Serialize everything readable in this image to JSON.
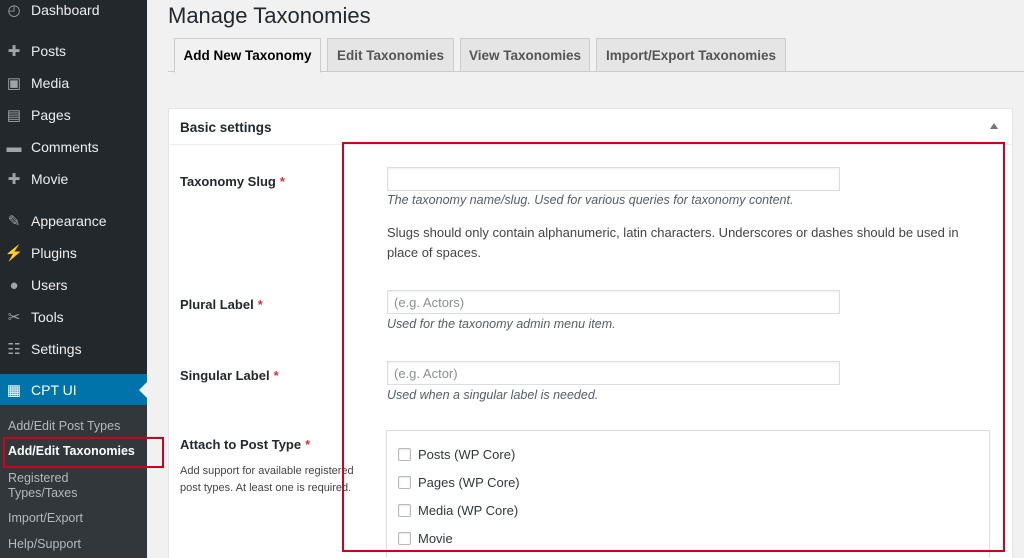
{
  "sidebar": {
    "items": [
      {
        "label": "Dashboard",
        "icon": "dashboard-icon"
      },
      {
        "label": "Posts",
        "icon": "pin-icon"
      },
      {
        "label": "Media",
        "icon": "media-icon"
      },
      {
        "label": "Pages",
        "icon": "pages-icon"
      },
      {
        "label": "Comments",
        "icon": "comments-icon"
      },
      {
        "label": "Movie",
        "icon": "pin-icon"
      },
      {
        "label": "Appearance",
        "icon": "appearance-icon"
      },
      {
        "label": "Plugins",
        "icon": "plugins-icon"
      },
      {
        "label": "Users",
        "icon": "users-icon"
      },
      {
        "label": "Tools",
        "icon": "tools-icon"
      },
      {
        "label": "Settings",
        "icon": "settings-icon"
      },
      {
        "label": "CPT UI",
        "icon": "grid-icon"
      }
    ],
    "submenu": [
      "Add/Edit Post Types",
      "Add/Edit Taxonomies",
      "Registered",
      "Types/Taxes",
      "Import/Export",
      "Help/Support"
    ]
  },
  "page": {
    "title": "Manage Taxonomies"
  },
  "tabs": [
    "Add New Taxonomy",
    "Edit Taxonomies",
    "View Taxonomies",
    "Import/Export Taxonomies"
  ],
  "panel": {
    "title": "Basic settings",
    "required_marker": "*",
    "slug": {
      "label": "Taxonomy Slug",
      "value": "",
      "help": "The taxonomy name/slug. Used for various queries for taxonomy content.",
      "note_line1": "Slugs should only contain alphanumeric, latin characters. Underscores or dashes should be used in",
      "note_line2": "place of spaces."
    },
    "plural": {
      "label": "Plural Label",
      "placeholder": "(e.g. Actors)",
      "help": "Used for the taxonomy admin menu item."
    },
    "singular": {
      "label": "Singular Label",
      "placeholder": "(e.g. Actor)",
      "help": "Used when a singular label is needed."
    },
    "attach": {
      "label": "Attach to Post Type",
      "desc_line1": "Add support for available registered",
      "desc_line2": "post types. At least one is required.",
      "options": [
        "Posts (WP Core)",
        "Pages (WP Core)",
        "Media (WP Core)",
        "Movie"
      ]
    }
  },
  "colors": {
    "sidebar_bg": "#23282d",
    "active_menu": "#0073aa",
    "highlight": "#d0021b",
    "required": "#dc3232"
  }
}
